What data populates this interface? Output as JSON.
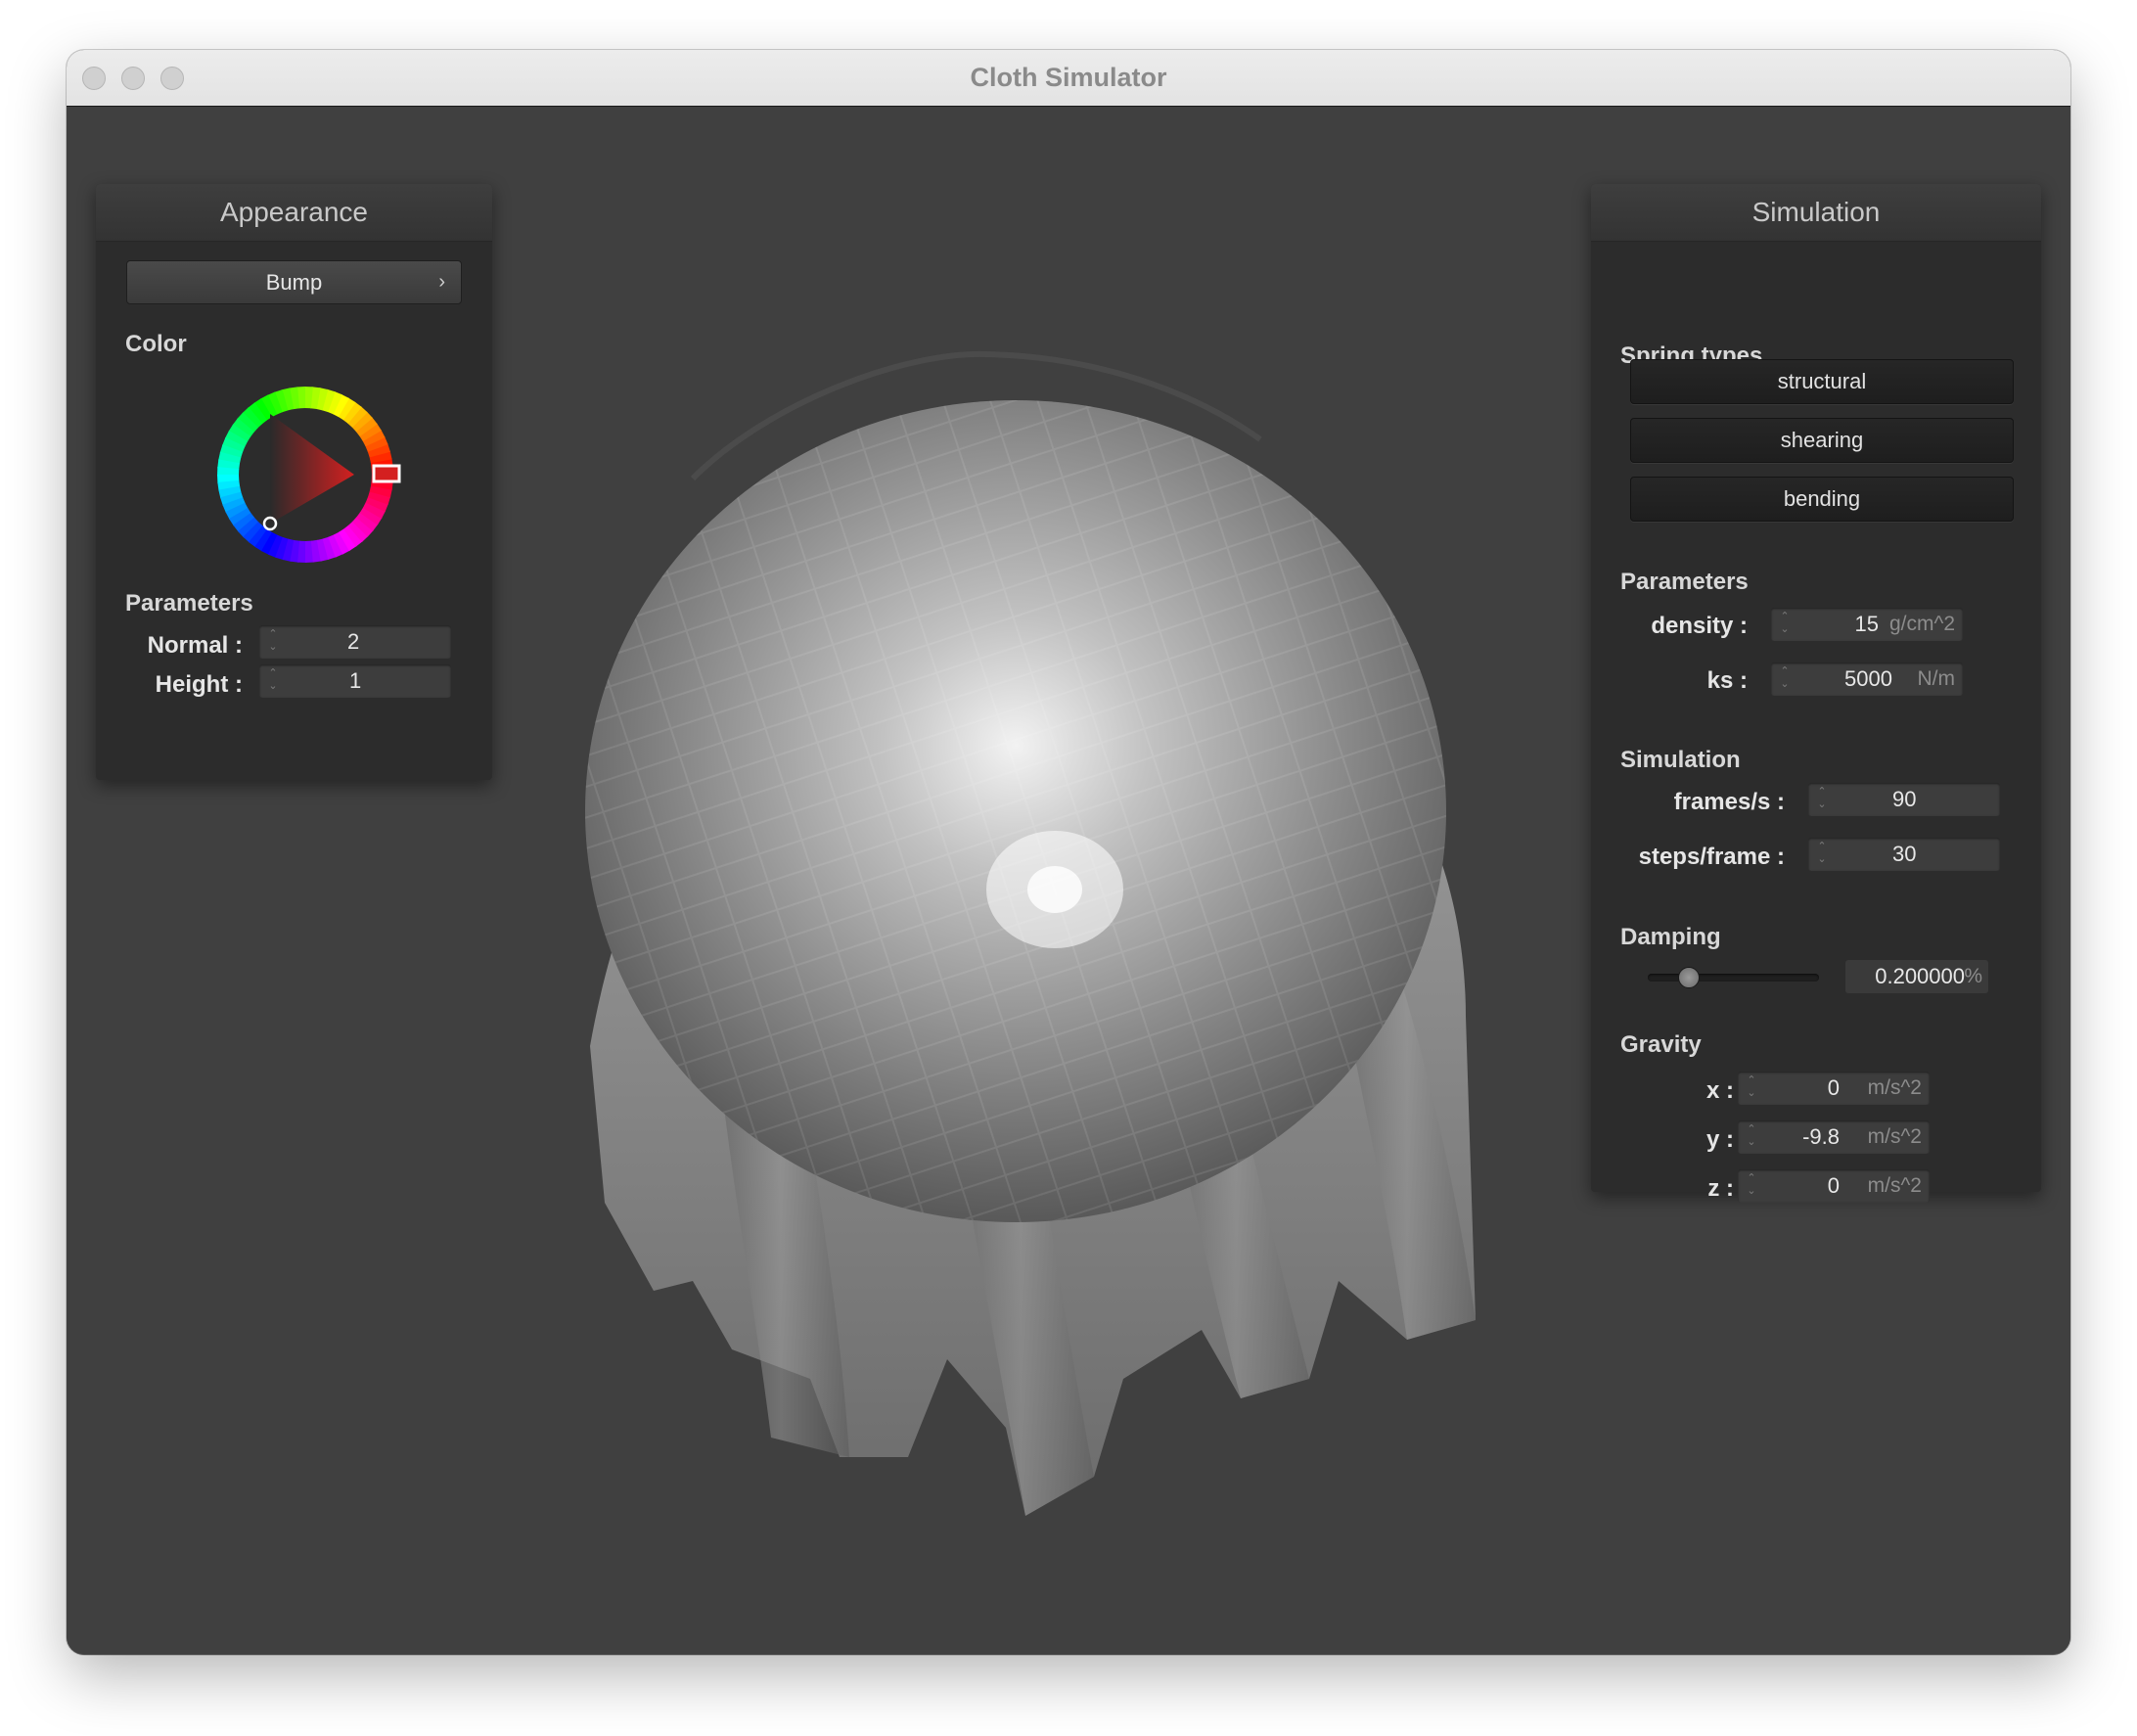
{
  "window": {
    "title": "Cloth Simulator"
  },
  "appearance": {
    "header": "Appearance",
    "shader_dropdown": {
      "selected": "Bump",
      "chevron": "›"
    },
    "color_label": "Color",
    "color_value": "#d42020",
    "parameters_label": "Parameters",
    "normal": {
      "label": "Normal :",
      "value": "2"
    },
    "height": {
      "label": "Height :",
      "value": "1"
    }
  },
  "simulation": {
    "header": "Simulation",
    "spring_types_label": "Spring types",
    "spring_types": [
      "structural",
      "shearing",
      "bending"
    ],
    "parameters_label": "Parameters",
    "density": {
      "label": "density :",
      "value": "15",
      "unit": "g/cm^2"
    },
    "ks": {
      "label": "ks :",
      "value": "5000",
      "unit": "N/m"
    },
    "simulation_label": "Simulation",
    "frames_per_sec": {
      "label": "frames/s :",
      "value": "90"
    },
    "steps_per_frame": {
      "label": "steps/frame :",
      "value": "30"
    },
    "damping_label": "Damping",
    "damping": {
      "value": "0.200000",
      "unit": "%",
      "slider_fraction": 0.2
    },
    "gravity_label": "Gravity",
    "gravity": {
      "x": {
        "label": "x :",
        "value": "0",
        "unit": "m/s^2"
      },
      "y": {
        "label": "y :",
        "value": "-9.8",
        "unit": "m/s^2"
      },
      "z": {
        "label": "z :",
        "value": "0",
        "unit": "m/s^2"
      }
    }
  }
}
